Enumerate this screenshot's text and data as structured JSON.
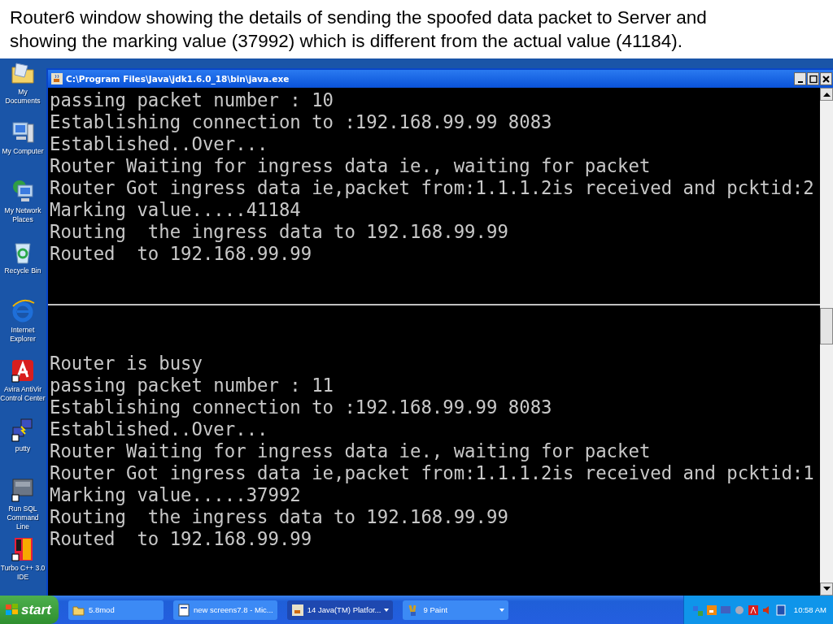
{
  "caption": "Router6 window showing the details of sending the spoofed data packet to Server and showing the marking value (37992) which is different from the actual value (41184).",
  "desktop_icons": [
    {
      "label": "My Documents"
    },
    {
      "label": "My Computer"
    },
    {
      "label": "My Network Places"
    },
    {
      "label": "Recycle Bin"
    },
    {
      "label": "Internet Explorer"
    },
    {
      "label": "Avira AntiVir Control Center"
    },
    {
      "label": "putty"
    },
    {
      "label": "Run SQL Command Line"
    },
    {
      "label": "Turbo C++ 3.0 IDE"
    }
  ],
  "window": {
    "title": "C:\\Program Files\\Java\\jdk1.6.0_18\\bin\\java.exe"
  },
  "console": {
    "blocks": [
      [
        "passing packet number : 10",
        "Establishing connection to :192.168.99.99 8083",
        "Established..Over...",
        "Router Waiting for ingress data ie., waiting for packet",
        "Router Got ingress data ie,packet from:1.1.1.2is received and pcktid:2",
        "Marking value.....41184",
        "Routing  the ingress data to 192.168.99.99",
        "Routed  to 192.168.99.99"
      ],
      [
        "Router is busy",
        "passing packet number : 11",
        "Establishing connection to :192.168.99.99 8083",
        "Established..Over...",
        "Router Waiting for ingress data ie., waiting for packet",
        "Router Got ingress data ie,packet from:1.1.1.2is received and pcktid:1",
        "Marking value.....37992",
        "Routing  the ingress data to 192.168.99.99",
        "Routed  to 192.168.99.99"
      ]
    ]
  },
  "taskbar": {
    "start": "start",
    "items": [
      {
        "label": "5.8mod",
        "selected": false,
        "grouped": false
      },
      {
        "label": "new screens7.8 - Mic...",
        "selected": false,
        "grouped": false
      },
      {
        "label": "14 Java(TM) Platfor...",
        "selected": true,
        "grouped": true
      },
      {
        "label": "9 Paint",
        "selected": false,
        "grouped": true
      }
    ],
    "clock": "10:58 AM"
  }
}
